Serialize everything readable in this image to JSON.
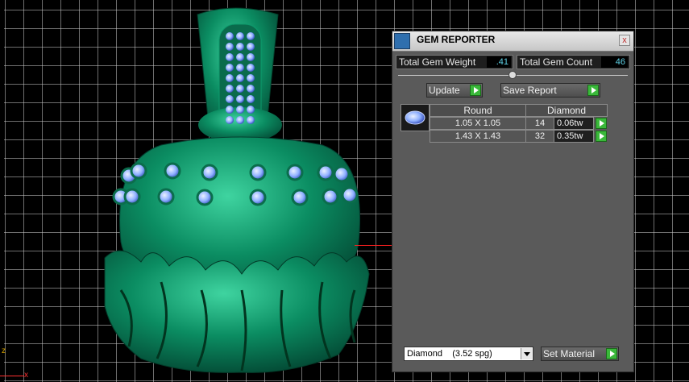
{
  "panel": {
    "title": "GEM REPORTER",
    "close_label": "x",
    "total_weight_label": "Total Gem Weight",
    "total_weight_value": ".41",
    "total_count_label": "Total Gem Count",
    "total_count_value": "46",
    "update_label": "Update",
    "save_report_label": "Save Report"
  },
  "gem_table": {
    "headers": [
      "Round",
      "Diamond"
    ],
    "rows": [
      {
        "size": "1.05 X 1.05",
        "count": "14",
        "weight": "0.06tw"
      },
      {
        "size": "1.43 X 1.43",
        "count": "32",
        "weight": "0.35tw"
      }
    ]
  },
  "material": {
    "selected": "Diamond    (3.52 spg)",
    "set_label": "Set Material"
  },
  "viewport": {
    "axis_z": "z",
    "axis_x": "x"
  },
  "colors": {
    "model_green": "#0a8f64",
    "gem_blue": "#8fb0ff",
    "accent_go": "#3ab83a",
    "value_cyan": "#5fd3e8"
  }
}
